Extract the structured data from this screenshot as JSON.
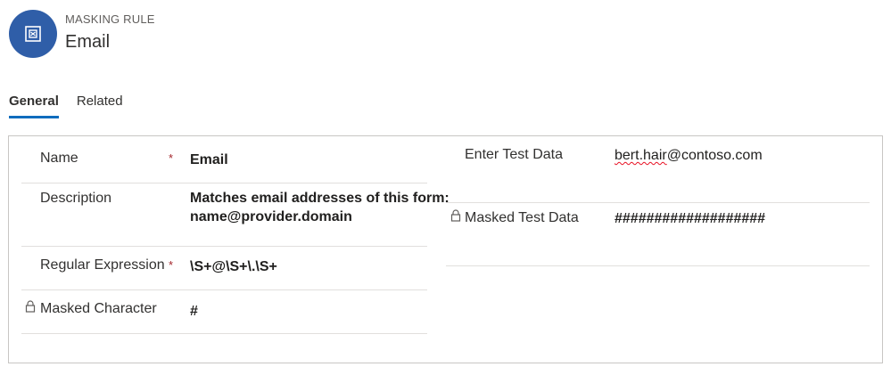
{
  "header": {
    "entity_type": "MASKING RULE",
    "record_name": "Email",
    "avatar_icon": "masking-rule-icon",
    "avatar_color": "#2f5ea8"
  },
  "tabs": [
    {
      "label": "General",
      "active": true
    },
    {
      "label": "Related",
      "active": false
    }
  ],
  "left_fields": {
    "name": {
      "label": "Name",
      "value": "Email",
      "required": "*"
    },
    "description": {
      "label": "Description",
      "value_line1": "Matches email addresses of this form:",
      "value_line2": "name@provider.domain"
    },
    "regex": {
      "label": "Regular Expression",
      "value": "\\S+@\\S+\\.\\S+",
      "required": "*"
    },
    "masked_char": {
      "label": "Masked Character",
      "value": "#",
      "locked_icon": "lock-icon"
    }
  },
  "right_fields": {
    "test_data": {
      "label": "Enter Test Data",
      "value_user": "bert.hair",
      "value_domain": "@contoso.com"
    },
    "masked_test_data": {
      "label": "Masked Test Data",
      "value": "###################",
      "locked_icon": "lock-icon"
    }
  },
  "colors": {
    "accent": "#0f6cbd",
    "required": "#a4262c"
  }
}
